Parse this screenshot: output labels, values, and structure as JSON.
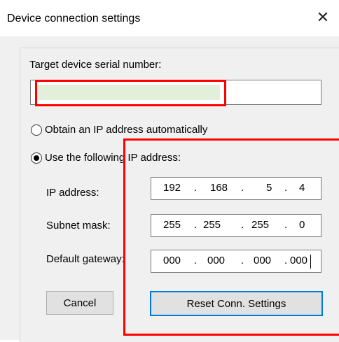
{
  "window": {
    "title": "Device connection settings",
    "close_glyph": "✕"
  },
  "serial": {
    "label": "Target device serial number:",
    "value": ""
  },
  "ip_mode": {
    "auto_label": "Obtain an IP address automatically",
    "auto_checked": false,
    "manual_label": "Use the following IP address:",
    "manual_checked": true
  },
  "fields": {
    "ip_label": "IP address:",
    "ip": [
      "192",
      "168",
      "5",
      "4"
    ],
    "subnet_label": "Subnet mask:",
    "subnet": [
      "255",
      "255",
      "255",
      "0"
    ],
    "gateway_label": "Default gateway:",
    "gateway": [
      "000",
      "000",
      "000",
      "000"
    ],
    "dot": "."
  },
  "buttons": {
    "cancel": "Cancel",
    "reset": "Reset Conn. Settings"
  },
  "colors": {
    "highlight": "#ff0000",
    "serial_fill": "#e2efda",
    "default_button_border": "#0078d7"
  }
}
